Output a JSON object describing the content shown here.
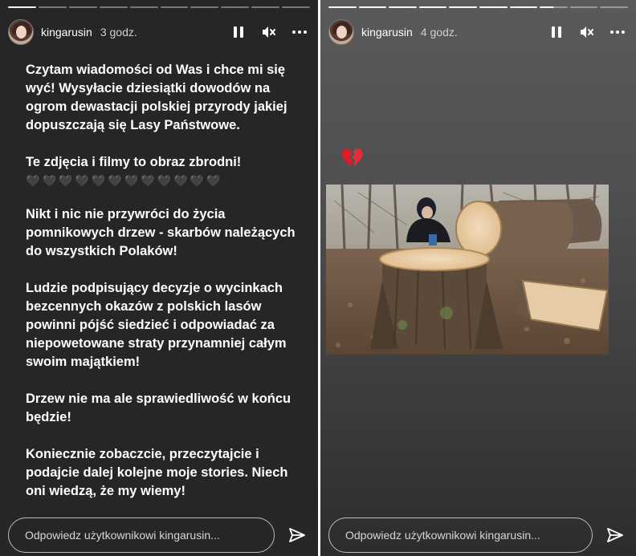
{
  "left_story": {
    "progress": {
      "total": 10,
      "completed": 1
    },
    "user": {
      "username": "kingarusin",
      "time": "3 godz."
    },
    "text": {
      "p1": "Czytam wiadomości od Was i chce mi się wyć! Wysyłacie dziesiątki dowodów na ogrom dewastacji polskiej przyrody jakiej dopuszczają się Lasy Państwowe.",
      "p2": "Te zdjęcia i filmy to obraz zbrodni!",
      "hearts": [
        "🖤",
        "🖤",
        "🖤",
        "🖤",
        "🖤",
        "🖤",
        "🖤",
        "🖤",
        "🖤",
        "🖤",
        "🖤",
        "🖤"
      ],
      "p3": "Nikt i nic nie przywróci do życia pomnikowych drzew - skarbów należących do wszystkich Polaków!",
      "p4": "Ludzie podpisujący decyzje o wycinkach bezcennych okazów z polskich lasów powinni pójść siedzieć i odpowiadać za niepowetowane straty przynamniej całym swoim majątkiem!",
      "p5": "Drzew nie ma ale sprawiedliwość w końcu będzie!",
      "p6": "Koniecznie zobaczcie, przeczytajcie i podajcie dalej kolejne moje stories. Niech oni wiedzą, że my wiemy!"
    },
    "reply_placeholder": "Odpowiedz użytkownikowi kingarusin..."
  },
  "right_story": {
    "progress": {
      "total": 10,
      "completed": 7,
      "current_fraction": 0.5
    },
    "user": {
      "username": "kingarusin",
      "time": "4 godz."
    },
    "emoji": "broken-heart",
    "photo": "person crouching beside large felled tree trunks and a stump in a forest",
    "reply_placeholder": "Odpowiedz użytkownikowi kingarusin..."
  },
  "icons": [
    "pause-icon",
    "mute-icon",
    "more-icon",
    "send-icon"
  ]
}
